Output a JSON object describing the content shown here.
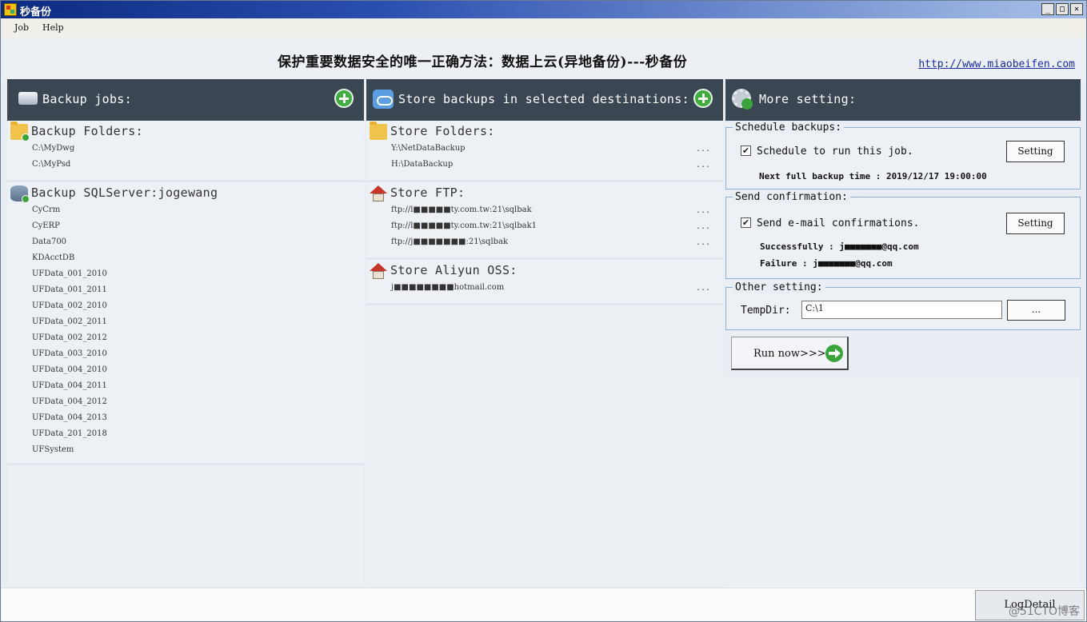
{
  "window": {
    "title": "秒备份",
    "min_glyph": "_",
    "max_glyph": "□",
    "close_glyph": "✕"
  },
  "menu": {
    "job": "Job",
    "help": "Help"
  },
  "header": {
    "slogan": "保护重要数据安全的唯一正确方法：数据上云(异地备份)---秒备份",
    "website": "http://www.miaobeifen.com"
  },
  "backup_jobs": {
    "title": "Backup jobs:",
    "folders": {
      "title": "Backup Folders:",
      "items": [
        "C:\\MyDwg",
        "C:\\MyPsd"
      ]
    },
    "sqlserver": {
      "title": "Backup SQLServer:jogewang",
      "items": [
        "CyCrm",
        "CyERP",
        "Data700",
        "KDAcctDB",
        "UFData_001_2010",
        "UFData_001_2011",
        "UFData_002_2010",
        "UFData_002_2011",
        "UFData_002_2012",
        "UFData_003_2010",
        "UFData_004_2010",
        "UFData_004_2011",
        "UFData_004_2012",
        "UFData_004_2013",
        "UFData_201_2018",
        "UFSystem"
      ]
    }
  },
  "destinations": {
    "title": "Store backups in selected destinations:",
    "folders": {
      "title": "Store Folders:",
      "items": [
        "Y:\\NetDataBackup",
        "H:\\DataBackup"
      ]
    },
    "ftp": {
      "title": "Store FTP:",
      "items": [
        "ftp://l■■■■■ty.com.tw:21\\sqlbak",
        "ftp://l■■■■■ty.com.tw:21\\sqlbak1",
        "ftp://j■■■■■■■:21\\sqlbak"
      ]
    },
    "oss": {
      "title": "Store Aliyun OSS:",
      "items": [
        "j■■■■■■■■hotmail.com"
      ]
    },
    "more_label": "..."
  },
  "more_setting": {
    "title": "More setting:",
    "schedule": {
      "group": "Schedule backups:",
      "check_label": "Schedule to run this job.",
      "checked_glyph": "✔",
      "button": "Setting",
      "next_backup": "Next full backup time : 2019/12/17 19:00:00"
    },
    "confirmation": {
      "group": "Send confirmation:",
      "check_label": "Send e-mail confirmations.",
      "checked_glyph": "✔",
      "button": "Setting",
      "success": "Successfully : j■■■■■■■@qq.com",
      "failure": "Failure : j■■■■■■■@qq.com"
    },
    "other": {
      "group": "Other setting:",
      "tempdir_label": "TempDir:",
      "tempdir_value": "C:\\1",
      "browse": "..."
    },
    "run": "Run now>>>>"
  },
  "footer": {
    "log_button": "LogDetail",
    "watermark": "@51CTO博客"
  }
}
